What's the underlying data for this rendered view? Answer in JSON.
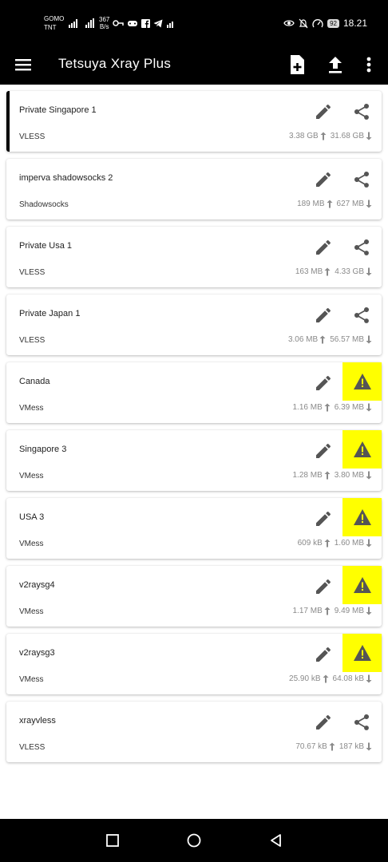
{
  "status_bar": {
    "carrier_line1": "GOMO",
    "carrier_line2": "TNT",
    "speed_value": "367",
    "speed_unit": "B/s",
    "battery": "92",
    "time": "18.21",
    "icons": [
      "signal-icon",
      "wifi-icon",
      "vpn-key-icon",
      "game-icon",
      "facebook-icon",
      "telegram-icon",
      "eye-icon",
      "bell-off-icon",
      "gauge-icon"
    ]
  },
  "toolbar": {
    "title": "Tetsuya Xray Plus",
    "icons": [
      "menu-icon",
      "add-file-icon",
      "upload-icon",
      "more-vert-icon"
    ]
  },
  "servers": [
    {
      "name": "Private Singapore 1",
      "type": "VLESS",
      "up": "3.38 GB",
      "down": "31.68 GB",
      "action": "share",
      "selected": true
    },
    {
      "name": "imperva shadowsocks 2",
      "type": "Shadowsocks",
      "up": "189 MB",
      "down": "627 MB",
      "action": "share",
      "selected": false
    },
    {
      "name": "Private Usa 1",
      "type": "VLESS",
      "up": "163 MB",
      "down": "4.33 GB",
      "action": "share",
      "selected": false
    },
    {
      "name": "Private Japan 1",
      "type": "VLESS",
      "up": "3.06 MB",
      "down": "56.57 MB",
      "action": "share",
      "selected": false
    },
    {
      "name": "Canada",
      "type": "VMess",
      "up": "1.16 MB",
      "down": "6.39 MB",
      "action": "warning",
      "selected": false
    },
    {
      "name": "Singapore 3",
      "type": "VMess",
      "up": "1.28 MB",
      "down": "3.80 MB",
      "action": "warning",
      "selected": false
    },
    {
      "name": "USA 3",
      "type": "VMess",
      "up": "609 kB",
      "down": "1.60 MB",
      "action": "warning",
      "selected": false
    },
    {
      "name": "v2raysg4",
      "type": "VMess",
      "up": "1.17 MB",
      "down": "9.49 MB",
      "action": "warning",
      "selected": false
    },
    {
      "name": "v2raysg3",
      "type": "VMess",
      "up": "25.90 kB",
      "down": "64.08 kB",
      "action": "warning",
      "selected": false
    },
    {
      "name": "xrayvless",
      "type": "VLESS",
      "up": "70.67 kB",
      "down": "187 kB",
      "action": "share",
      "selected": false
    }
  ],
  "colors": {
    "toolbar_bg": "#000000",
    "warning_bg": "#ffff00",
    "selected_marker": "#000000",
    "icon_gray": "#555555",
    "traffic_text": "#8a8a8a"
  }
}
